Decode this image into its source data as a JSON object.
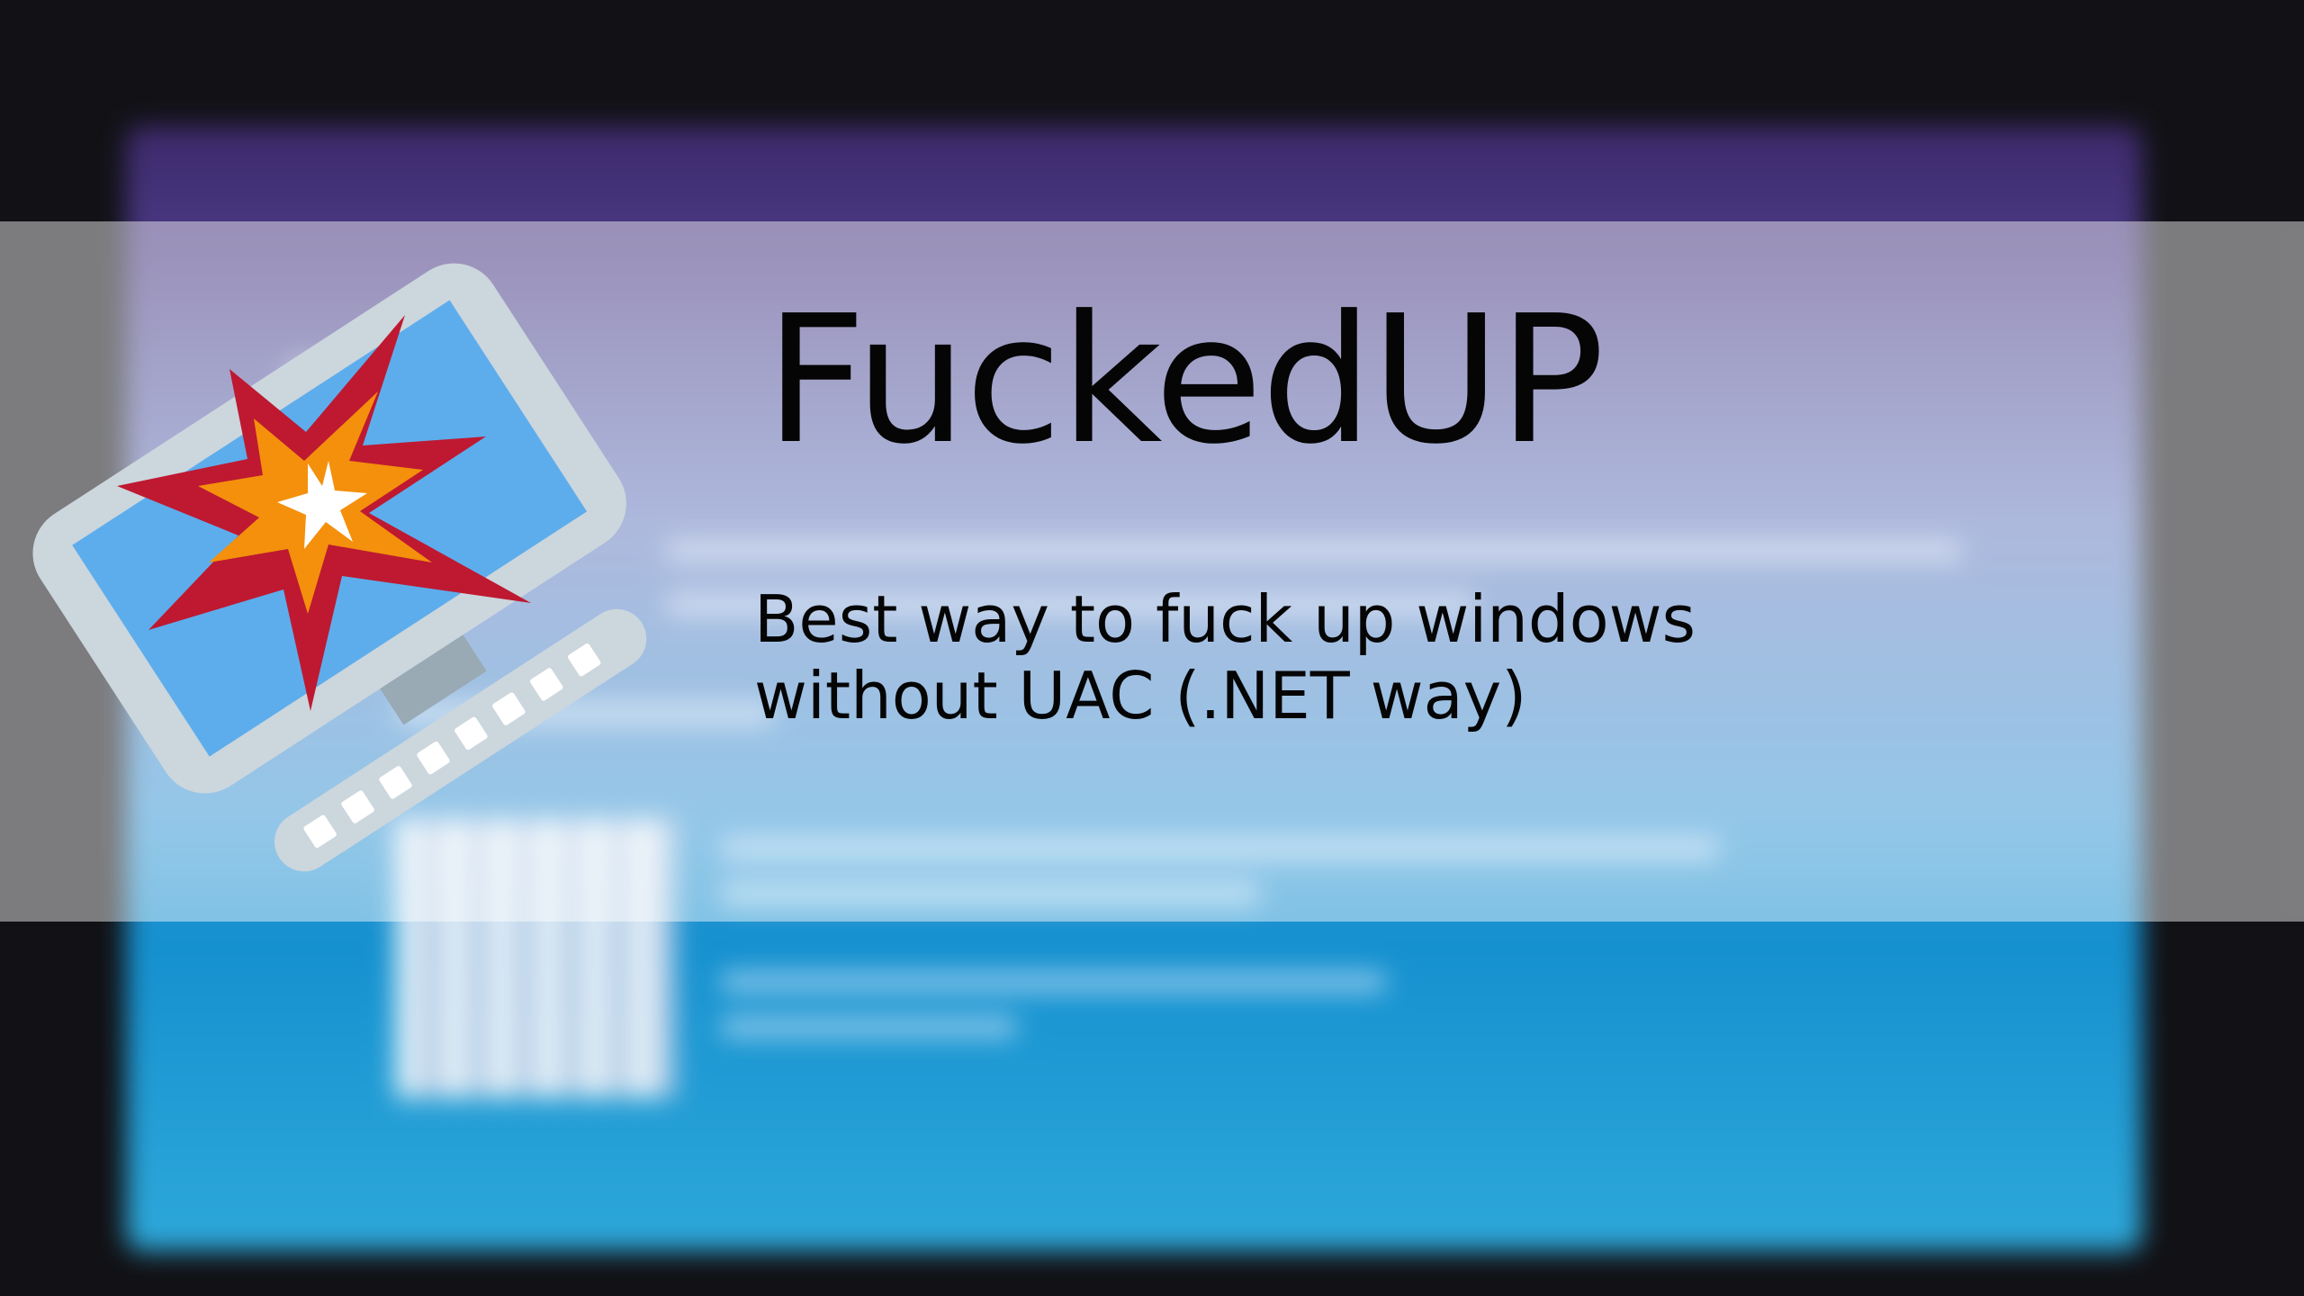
{
  "title": "FuckedUP",
  "subtitle": "Best way to fuck up windows without UAC (.NET way)",
  "emblem": {
    "icon": "exploding-computer-icon",
    "colors": {
      "frame": "#ccd6dd",
      "screen": "#5dadec",
      "keyboard": "#ccd6dd",
      "keys": "#ffffff",
      "explosion_outer": "#be1931",
      "explosion_middle": "#f4900c",
      "explosion_inner": "#ffffff"
    }
  },
  "colors": {
    "banner_overlay": "rgba(255,255,255,0.45)",
    "text": "#050505",
    "background": "#121216"
  }
}
